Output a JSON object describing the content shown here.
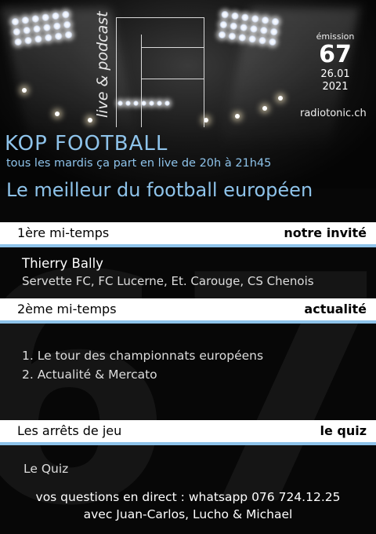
{
  "header": {
    "tagline_vertical": "live & podcast",
    "emission_label": "émission",
    "emission_number": "67",
    "emission_date_day": "26.01",
    "emission_date_year": "2021",
    "site": "radiotonic.ch"
  },
  "show": {
    "title": "KOP FOOTBALL",
    "schedule": "tous les mardis ça part en live de 20h à 21h45",
    "banner": "Le meilleur du football européen"
  },
  "segment1": {
    "label": "1ère mi-temps",
    "tag": "notre invité"
  },
  "guest": {
    "name": "Thierry Bally",
    "clubs": "Servette FC, FC Lucerne, Et. Carouge, CS Chenois"
  },
  "segment2": {
    "label": "2ème mi-temps",
    "tag": "actualité"
  },
  "news": {
    "items": [
      "1. Le tour des championnats européens",
      "2. Actualité & Mercato"
    ]
  },
  "segment3": {
    "label": "Les arrêts de jeu",
    "tag": "le quiz"
  },
  "quiz": {
    "text": "Le Quiz"
  },
  "footer": {
    "contact": "vos questions en direct : whatsapp 076 724.12.25",
    "hosts": "avec Juan-Carlos, Lucho & Michael"
  },
  "colors": {
    "accent": "#8ec3ea",
    "background": "#070707"
  }
}
